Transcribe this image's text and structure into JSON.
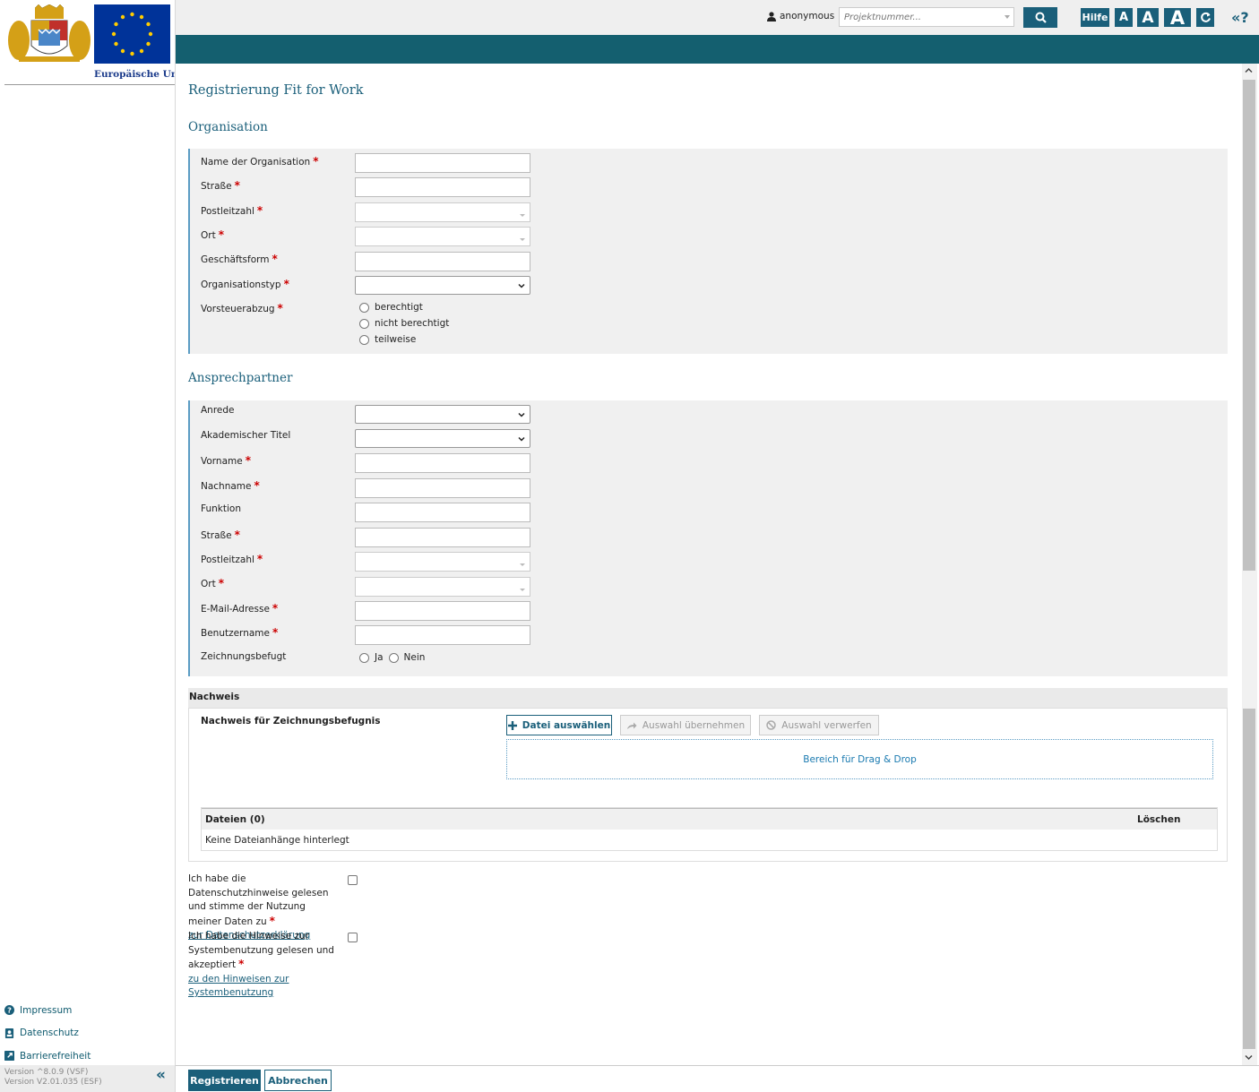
{
  "sidebar": {
    "eu_text": "Europäische Union",
    "footer_links": [
      {
        "label": "Impressum",
        "icon": "question-circle-icon"
      },
      {
        "label": "Datenschutz",
        "icon": "user-badge-icon"
      },
      {
        "label": "Barrierefreiheit",
        "icon": "external-link-icon"
      }
    ],
    "version_vsf": "Version ^8.0.9 (VSF)",
    "version_esf": "Version V2.01.035 (ESF)",
    "collapse_label": "«"
  },
  "topbar": {
    "user": "anonymous",
    "project_placeholder": "Projektnummer...",
    "help_button": "Hilfe",
    "font_small": "A",
    "font_medium": "A",
    "font_large": "A",
    "help_icon_label": "«?"
  },
  "page": {
    "title": "Registrierung Fit for Work"
  },
  "organisation": {
    "heading": "Organisation",
    "fields": {
      "name": "Name der Organisation",
      "strasse": "Straße",
      "plz": "Postleitzahl",
      "ort": "Ort",
      "geschaeftsform": "Geschäftsform",
      "organisationstyp": "Organisationstyp",
      "vorsteuerabzug": "Vorsteuerabzug"
    },
    "vorsteuer_options": [
      "berechtigt",
      "nicht berechtigt",
      "teilweise"
    ]
  },
  "ansprechpartner": {
    "heading": "Ansprechpartner",
    "fields": {
      "anrede": "Anrede",
      "titel": "Akademischer Titel",
      "vorname": "Vorname",
      "nachname": "Nachname",
      "funktion": "Funktion",
      "strasse": "Straße",
      "plz": "Postleitzahl",
      "ort": "Ort",
      "email": "E-Mail-Adresse",
      "benutzername": "Benutzername",
      "zeichnungsbefugt": "Zeichnungsbefugt"
    },
    "zeichnung_options": [
      "Ja",
      "Nein"
    ]
  },
  "nachweis": {
    "heading": "Nachweis",
    "label": "Nachweis für Zeichnungsbefugnis",
    "select_button": "Datei auswählen",
    "apply_button": "Auswahl übernehmen",
    "discard_button": "Auswahl verwerfen",
    "dropzone": "Bereich für Drag & Drop",
    "files_header": "Dateien (0)",
    "delete_header": "Löschen",
    "empty_text": "Keine Dateianhänge hinterlegt"
  },
  "consents": {
    "privacy_text": "Ich habe die Datenschutzhinweise gelesen und stimme der Nutzung meiner Daten zu",
    "privacy_link": "zur Datenschutzerklärung",
    "usage_text": "Ich habe die Hinweise zur Systembenutzung gelesen und akzeptiert",
    "usage_link": "zu den Hinweisen zur Systembenutzung"
  },
  "actions": {
    "register": "Registrieren",
    "cancel": "Abbrechen"
  },
  "colors": {
    "primary": "#1a5f7a",
    "teal_bar": "#145f6f",
    "required": "#cc0000"
  }
}
